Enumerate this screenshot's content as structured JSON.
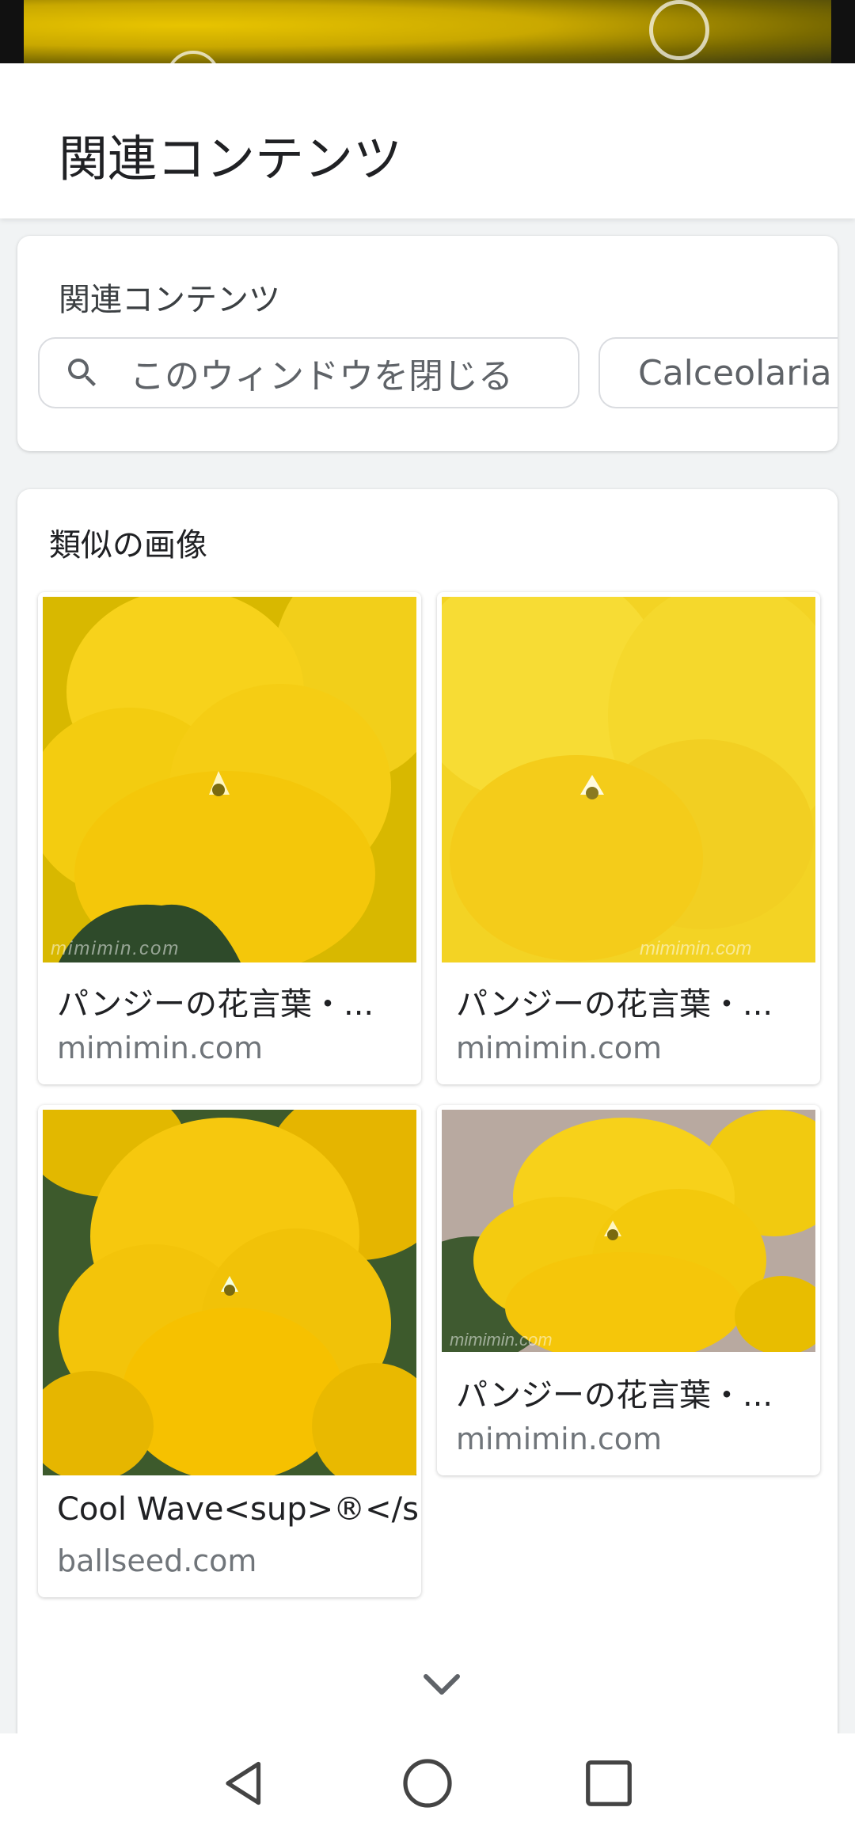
{
  "header": {
    "title": "関連コンテンツ"
  },
  "related": {
    "label": "関連コンテンツ",
    "chips": [
      {
        "label": "このウィンドウを閉じる",
        "icon": "search-icon"
      },
      {
        "label": "Calceolaria"
      }
    ]
  },
  "similar": {
    "label": "類似の画像",
    "items": [
      {
        "caption": "パンジーの花言葉・...",
        "source": "mimimin.com",
        "watermark": "mimimin.com"
      },
      {
        "caption": "パンジーの花言葉・...",
        "source": "mimimin.com",
        "watermark": "mimimin.com"
      },
      {
        "caption": "Cool Wave<sup>®</s...",
        "source": "ballseed.com"
      },
      {
        "caption": "パンジーの花言葉・...",
        "source": "mimimin.com",
        "watermark": "mimimin.com"
      }
    ],
    "more_icon": "chevron-down-icon"
  },
  "navbar": {
    "icons": [
      "back-icon",
      "home-icon",
      "recents-icon"
    ]
  },
  "colors": {
    "flower": "#f5c800",
    "accent": "#1a73e8"
  }
}
